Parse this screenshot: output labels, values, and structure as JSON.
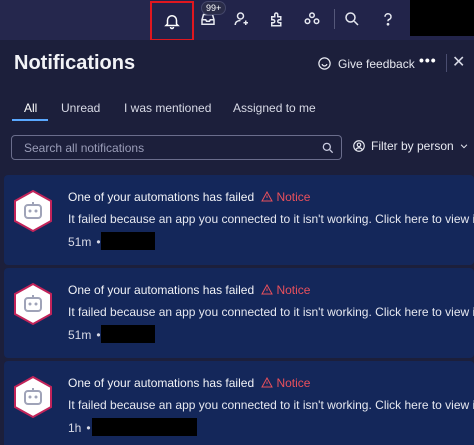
{
  "topbar": {
    "icons": [
      "bell-icon",
      "inbox-icon",
      "invite-member-icon",
      "apps-icon",
      "people-icon",
      "search-icon",
      "help-icon"
    ],
    "inbox_badge": "99+",
    "highlight_color": "#e0171f"
  },
  "panel": {
    "title": "Notifications",
    "feedback_label": "Give feedback",
    "more_label": "•••",
    "close_label": "✕"
  },
  "tabs": [
    {
      "label": "All",
      "active": true
    },
    {
      "label": "Unread",
      "active": false
    },
    {
      "label": "I was mentioned",
      "active": false
    },
    {
      "label": "Assigned to me",
      "active": false
    }
  ],
  "search": {
    "placeholder": "Search all notifications"
  },
  "filter": {
    "label": "Filter by person"
  },
  "notifications": [
    {
      "title": "One of your automations has failed",
      "tag": "Notice",
      "body": "It failed because an app you connected to it isn't working. Click here to view it.",
      "time": "51m"
    },
    {
      "title": "One of your automations has failed",
      "tag": "Notice",
      "body": "It failed because an app you connected to it isn't working. Click here to view it.",
      "time": "51m"
    },
    {
      "title": "One of your automations has failed",
      "tag": "Notice",
      "body": "It failed because an app you connected to it isn't working. Click here to view it.",
      "time": "1h"
    }
  ],
  "colors": {
    "accent": "#5aa8ff",
    "notice": "#e9505c",
    "card_bg": "#14275a"
  }
}
